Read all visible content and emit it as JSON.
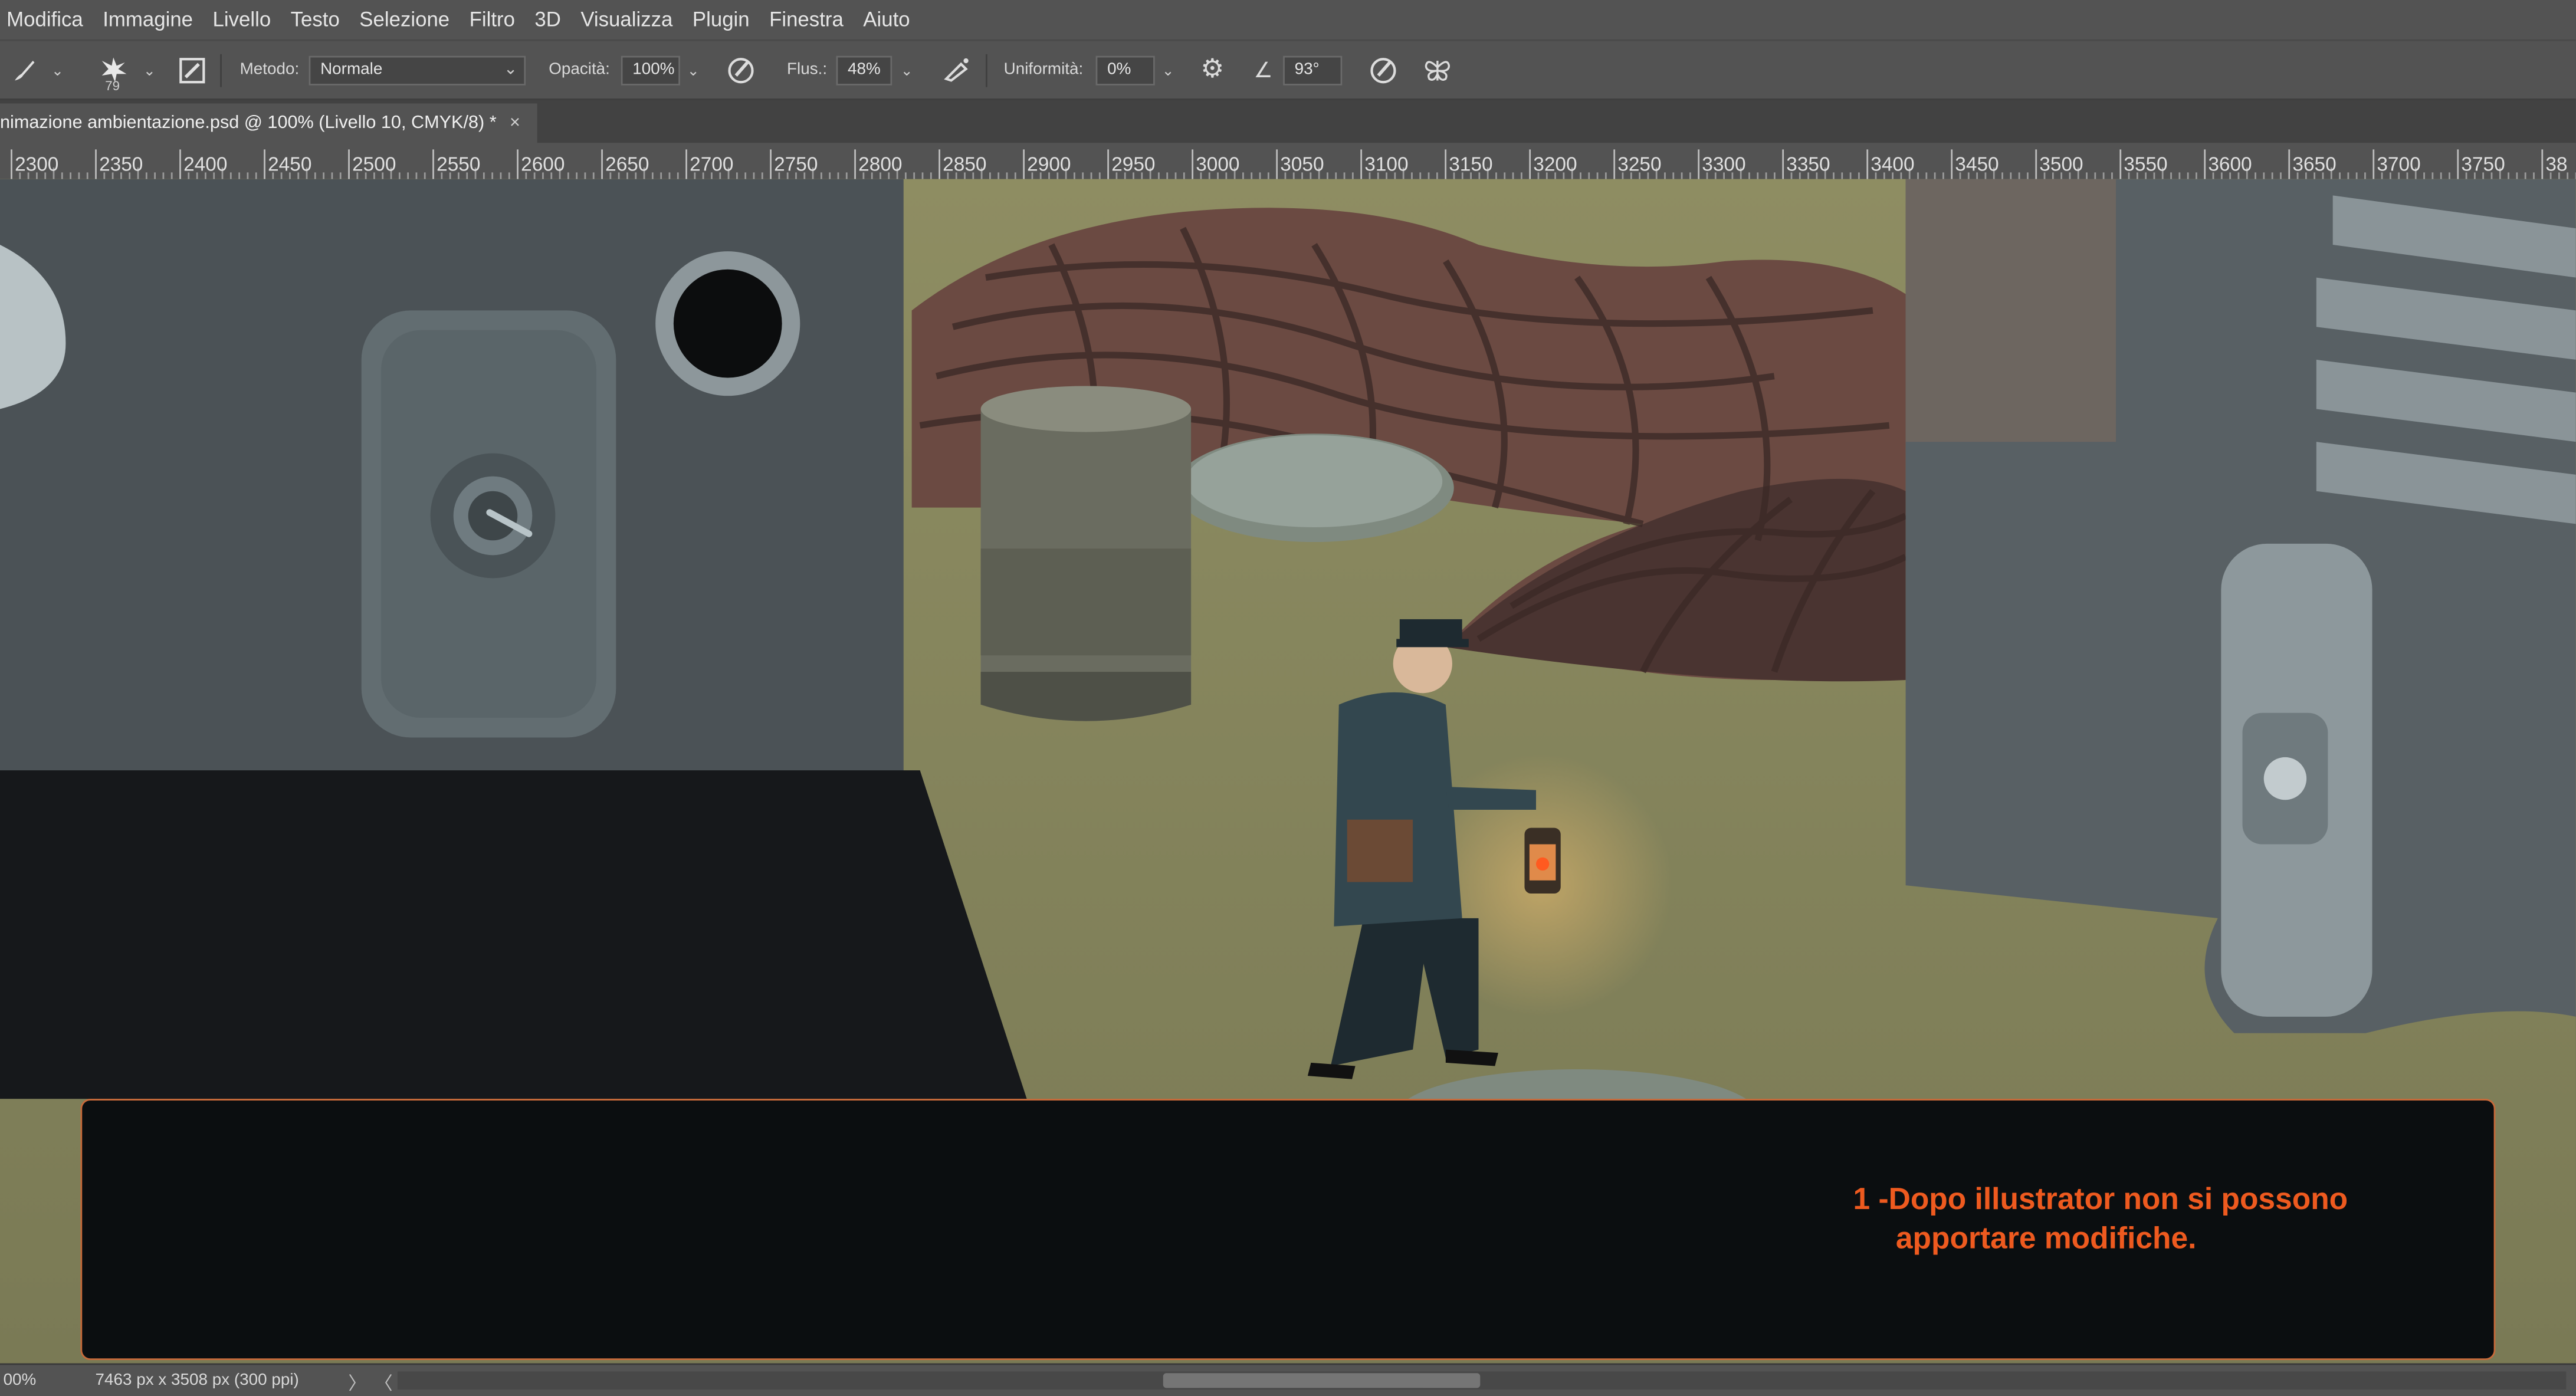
{
  "menu": [
    "Modifica",
    "Immagine",
    "Livello",
    "Testo",
    "Selezione",
    "Filtro",
    "3D",
    "Visualizza",
    "Plugin",
    "Finestra",
    "Aiuto"
  ],
  "options": {
    "brush_size": "79",
    "method_label": "Metodo:",
    "method_value": "Normale",
    "opacity_label": "Opacità:",
    "opacity_value": "100%",
    "flow_label": "Flus.:",
    "flow_value": "48%",
    "smoothing_label": "Uniformità:",
    "smoothing_value": "0%",
    "angle_value": "93°"
  },
  "document_tab": {
    "title": "nimazione ambientazione.psd @ 100% (Livello 10, CMYK/8) *",
    "close": "×"
  },
  "ruler_ticks": [
    "2300",
    "2350",
    "2400",
    "2450",
    "2500",
    "2550",
    "2600",
    "2650",
    "2700",
    "2750",
    "2800",
    "2850",
    "2900",
    "2950",
    "3000",
    "3050",
    "3100",
    "3150",
    "3200",
    "3250",
    "3300",
    "3350",
    "3400",
    "3450",
    "3500",
    "3550",
    "3600",
    "3650",
    "3700",
    "3750",
    "38"
  ],
  "overlay_text": {
    "line1": "1 -Dopo illustrator non si possono",
    "line2": "apportare modifiche."
  },
  "status": {
    "zoom": "00%",
    "doc_size": "7463 px x 3508 px (300 ppi)",
    "arrow_right": "〉",
    "arrow_left": "〈"
  },
  "colors": {
    "panel": "#535353",
    "accent_text": "#ee5a1f",
    "overlay_bg": "#0b0e10"
  }
}
